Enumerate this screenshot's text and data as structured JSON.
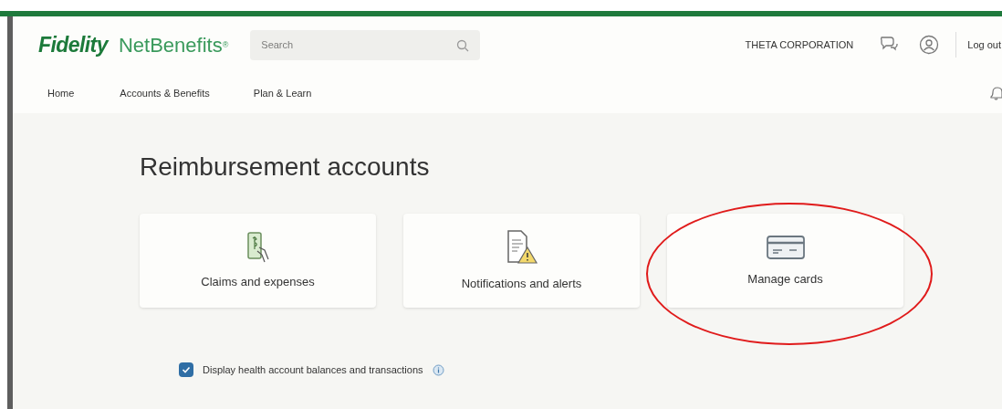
{
  "header": {
    "brand": "Fidelity",
    "product": "NetBenefits",
    "product_mark": "®",
    "search": {
      "placeholder": "Search"
    },
    "company": "THETA CORPORATION",
    "logout": "Log out"
  },
  "nav": [
    {
      "label": "Home"
    },
    {
      "label": "Accounts & Benefits"
    },
    {
      "label": "Plan & Learn"
    }
  ],
  "page_title": "Reimbursement accounts",
  "tiles": [
    {
      "kind": "claims",
      "label": "Claims and expenses",
      "highlighted": false
    },
    {
      "kind": "notifications",
      "label": "Notifications and alerts",
      "highlighted": false
    },
    {
      "kind": "cards",
      "label": "Manage cards",
      "highlighted": true
    }
  ],
  "display_option": {
    "label": "Display health account balances and transactions",
    "checked": true
  }
}
